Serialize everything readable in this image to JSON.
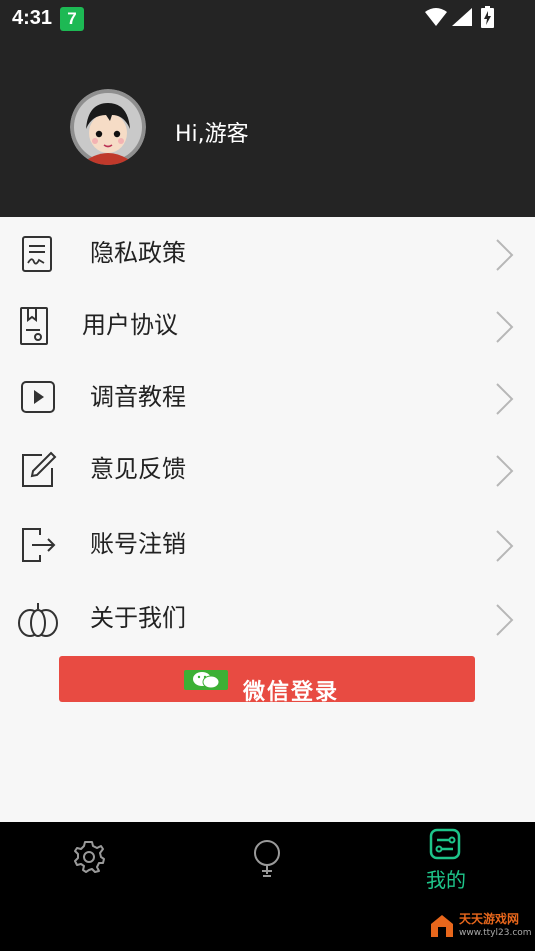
{
  "status_bar": {
    "time": "4:31",
    "app_badge": "7",
    "icons": [
      "wifi-icon",
      "signal-icon",
      "battery-charging-icon"
    ]
  },
  "profile": {
    "greeting": "Hi,游客",
    "avatar": "cartoon-avatar"
  },
  "menu": {
    "items": [
      {
        "label": "隐私政策",
        "icon": "document-sign-icon"
      },
      {
        "label": "用户协议",
        "icon": "agreement-icon"
      },
      {
        "label": "调音教程",
        "icon": "video-play-icon"
      },
      {
        "label": "意见反馈",
        "icon": "edit-icon"
      },
      {
        "label": "账号注销",
        "icon": "logout-icon"
      },
      {
        "label": "关于我们",
        "icon": "pumpkin-icon"
      }
    ]
  },
  "login_button": {
    "label": "微信登录",
    "icon": "wechat-icon",
    "color": "#e84b42"
  },
  "bottom_nav": {
    "tabs": [
      {
        "label": "",
        "icon": "settings-icon",
        "active": false
      },
      {
        "label": "",
        "icon": "bulb-icon",
        "active": false
      },
      {
        "label": "我的",
        "icon": "profile-settings-icon",
        "active": true
      }
    ],
    "active_color": "#1ec58a"
  },
  "watermark": {
    "text": "天天游戏网",
    "url": "www.ttyl23.com"
  }
}
